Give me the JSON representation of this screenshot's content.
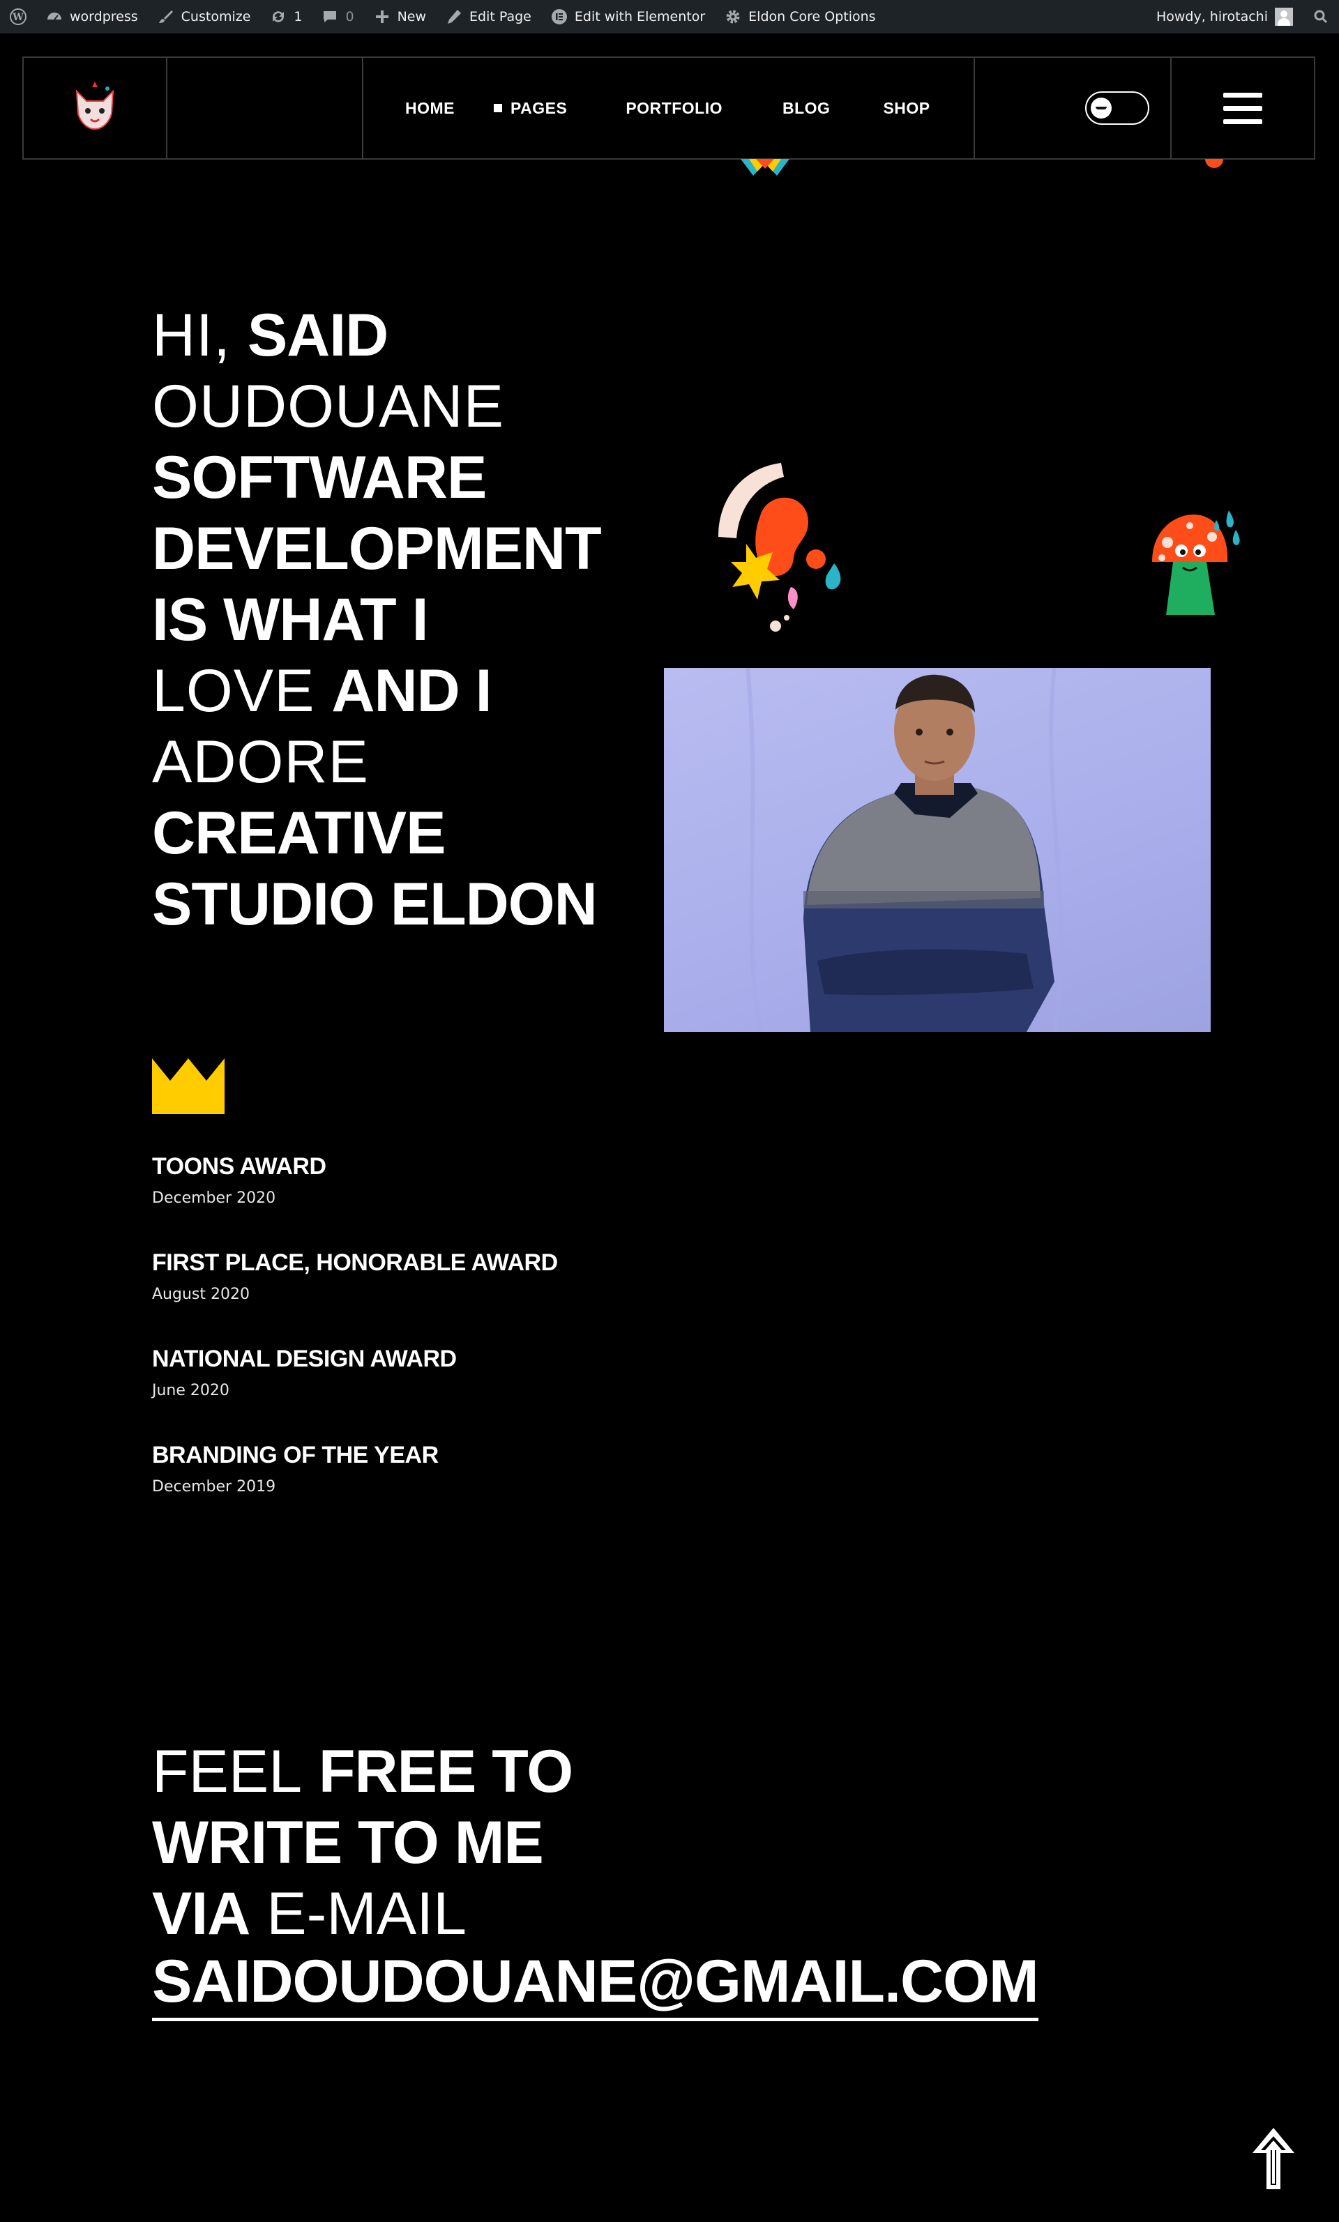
{
  "adminbar": {
    "site_name": "wordpress",
    "customize": "Customize",
    "updates_count": "1",
    "comments_count": "0",
    "new": "New",
    "edit_page": "Edit Page",
    "edit_elementor": "Edit with Elementor",
    "core_options": "Eldon Core Options",
    "greeting": "Howdy, hirotachi"
  },
  "nav": {
    "items": [
      "HOME",
      "PAGES",
      "PORTFOLIO",
      "BLOG",
      "SHOP"
    ]
  },
  "hero": {
    "line1_thin": "HI,",
    "line1_bold": "SAID",
    "line2_thin": "OUDOUANE",
    "line3_bold": "SOFTWARE",
    "line4_bold": "DEVELOPMENT",
    "line5_bold": "IS WHAT I",
    "line6_thin": "LOVE",
    "line6_bold": "AND I",
    "line7_thin": "ADORE",
    "line8_bold": "CREATIVE",
    "line9_bold": "STUDIO ELDON"
  },
  "awards": [
    {
      "name": "TOONS AWARD",
      "date": "December 2020"
    },
    {
      "name": "FIRST PLACE, HONORABLE AWARD",
      "date": "August 2020"
    },
    {
      "name": "NATIONAL DESIGN AWARD",
      "date": "June 2020"
    },
    {
      "name": "BRANDING OF THE YEAR",
      "date": "December 2019"
    }
  ],
  "contact": {
    "l1_thin": "FEEL",
    "l1_bold": "FREE TO",
    "l2_bold": "WRITE TO ME",
    "l3_bold": "VIA",
    "l3_thin": "E-MAIL",
    "email": "SAIDOUDOUANE@GMAIL.COM"
  },
  "colors": {
    "background": "#000000",
    "adminbar": "#1d2327",
    "crown": "#ffcc00",
    "portrait_bg": "#aeb2ee"
  },
  "icons": [
    "wordpress-icon",
    "dashboard-icon",
    "brush-icon",
    "refresh-icon",
    "comment-icon",
    "plus-icon",
    "pencil-icon",
    "elementor-icon",
    "gear-icon",
    "search-icon",
    "crown-icon",
    "arrow-up-icon",
    "hamburger-icon"
  ]
}
